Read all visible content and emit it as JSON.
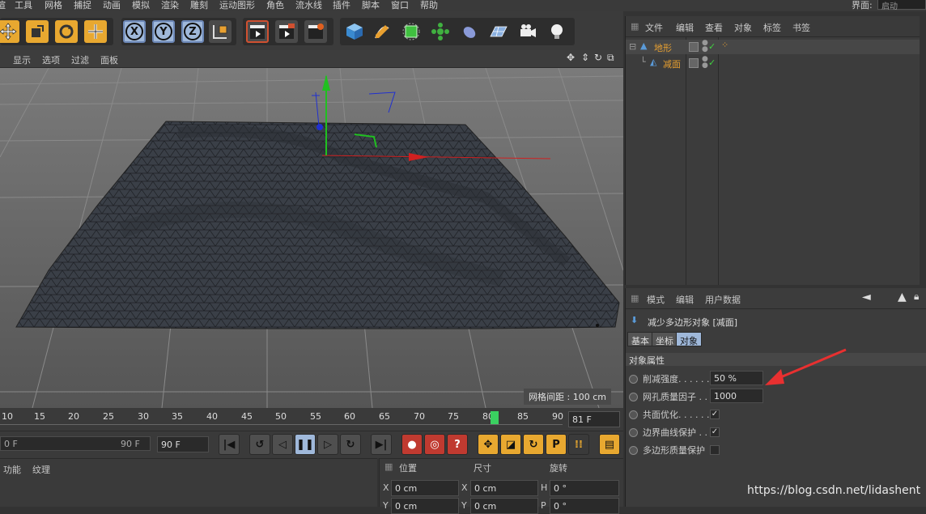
{
  "menubar": {
    "items": [
      "渲",
      "工具",
      "网格",
      "捕捉",
      "动画",
      "模拟",
      "渲染",
      "雕刻",
      "运动图形",
      "角色",
      "流水线",
      "插件",
      "脚本",
      "窗口",
      "帮助"
    ],
    "interface_label": "界面:",
    "interface_value": "启动"
  },
  "toolbar": {
    "axis_x": "X",
    "axis_y": "Y",
    "axis_z": "Z"
  },
  "viewport": {
    "menu": [
      "显示",
      "选项",
      "过滤",
      "面板"
    ],
    "grid_info": "网格间距 : 100 cm"
  },
  "timeline": {
    "ticks": [
      "10",
      "15",
      "20",
      "25",
      "30",
      "35",
      "40",
      "45",
      "50",
      "55",
      "60",
      "65",
      "70",
      "75",
      "80",
      "85",
      "90"
    ],
    "current_frame": "81 F"
  },
  "transport": {
    "start_field": "0 F",
    "end_inner": "90 F",
    "end_field": "90 F"
  },
  "material_bar": {
    "menu": [
      "功能",
      "纹理"
    ]
  },
  "coord_panel": {
    "headers": [
      "位置",
      "尺寸",
      "旋转"
    ],
    "rows": [
      {
        "a": "X",
        "pos": "0 cm",
        "b": "X",
        "size": "0 cm",
        "c": "H",
        "rot": "0 °"
      },
      {
        "a": "Y",
        "pos": "0 cm",
        "b": "Y",
        "size": "0 cm",
        "c": "P",
        "rot": "0 °"
      }
    ]
  },
  "object_manager": {
    "menu": [
      "文件",
      "编辑",
      "查看",
      "对象",
      "标签",
      "书签"
    ],
    "objects": [
      {
        "name": "地形",
        "color": "#e8a030"
      },
      {
        "name": "减面",
        "color": "#e8a030"
      }
    ]
  },
  "attribute_manager": {
    "menu": [
      "模式",
      "编辑",
      "用户数据"
    ],
    "object_title": "减少多边形对象 [减面]",
    "tabs": [
      "基本",
      "坐标",
      "对象"
    ],
    "section": "对象属性",
    "properties": [
      {
        "label": "削减强度. . . . . . .",
        "value": "50 %"
      },
      {
        "label": "网孔质量因子 . .",
        "value": "1000"
      },
      {
        "label": "共面优化. . . . . . .",
        "checked": "✓"
      },
      {
        "label": "边界曲线保护 . .",
        "checked": "✓"
      },
      {
        "label": "多边形质量保护",
        "checked": ""
      }
    ]
  },
  "watermark": "https://blog.csdn.net/lidashent",
  "colors": {
    "accent": "#e8a030",
    "axis_x": "#d02020",
    "axis_y": "#20c020",
    "axis_z": "#2030d0",
    "arrow": "#e83030"
  }
}
